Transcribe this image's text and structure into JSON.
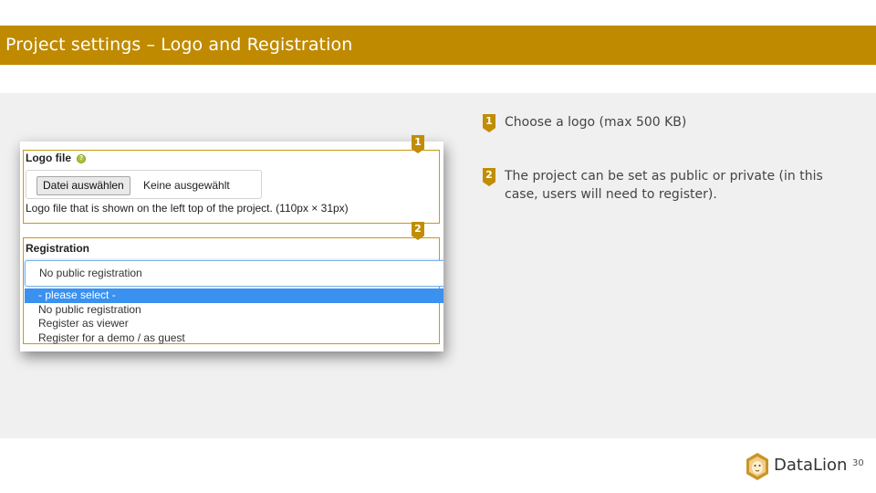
{
  "slide": {
    "title": "Project settings – Logo and Registration",
    "page_number": "30"
  },
  "screenshot": {
    "logo": {
      "label": "Logo file",
      "help_icon": "help-circle-icon",
      "button_label": "Datei auswählen",
      "no_file_text": "Keine ausgewählt",
      "hint": "Logo file that is shown on the left top of the project. (110px × 31px)"
    },
    "registration": {
      "label": "Registration",
      "selected_value": "No public registration",
      "options": [
        "- please select -",
        "No public registration",
        "Register as viewer",
        "Register for a demo / as guest"
      ],
      "highlighted_index": 0
    }
  },
  "annotations": [
    {
      "number": "1",
      "text": "Choose a logo (max 500 KB)"
    },
    {
      "number": "2",
      "text": "The project can be set as public or private (in this case, users will need to register)."
    }
  ],
  "brand": {
    "name": "DataLion",
    "logo_icon": "lion-head-icon"
  },
  "colors": {
    "accent": "#bf8a00",
    "marker": "#c18d05",
    "highlight_border": "#c79a12",
    "selected_option": "#3a91f0",
    "content_bg": "#f0f0f0"
  }
}
